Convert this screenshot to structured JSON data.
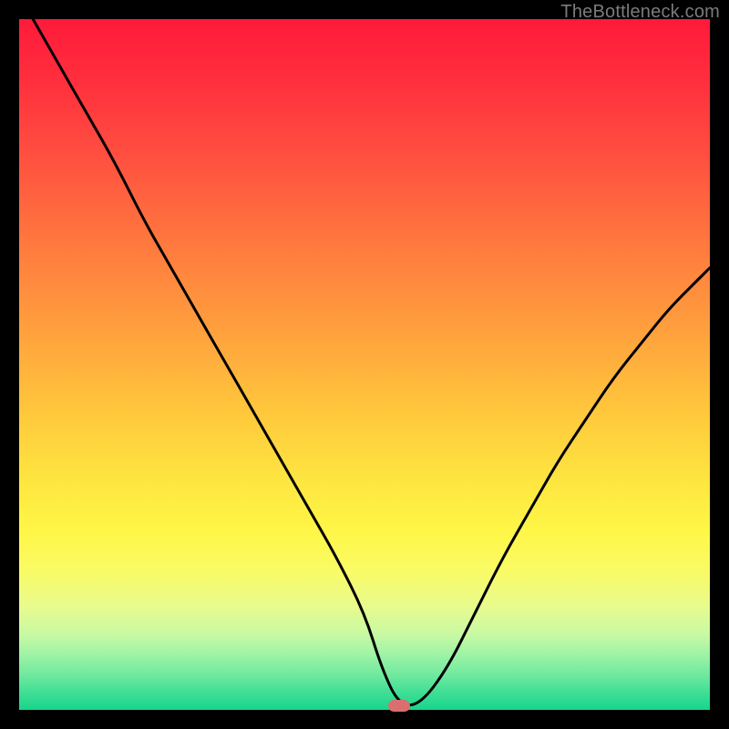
{
  "watermark": "TheBottleneck.com",
  "colors": {
    "frame": "#000000",
    "curve_stroke": "#000000",
    "marker_fill": "#d9706f",
    "watermark_text": "#7b7b7b"
  },
  "chart_data": {
    "type": "line",
    "title": "",
    "xlabel": "",
    "ylabel": "",
    "xlim": [
      0,
      100
    ],
    "ylim": [
      0,
      100
    ],
    "series": [
      {
        "name": "bottleneck-curve",
        "x": [
          2,
          6,
          10,
          14,
          18,
          22,
          26,
          30,
          34,
          38,
          42,
          46,
          50,
          52.5,
          55,
          58,
          62,
          66,
          70,
          74,
          78,
          82,
          86,
          90,
          94,
          98,
          100
        ],
        "y": [
          100,
          93,
          86,
          79,
          71,
          64,
          57,
          50,
          43,
          36,
          29,
          22,
          14,
          6,
          0.7,
          0.7,
          6,
          14,
          22,
          29,
          36,
          42,
          48,
          53,
          58,
          62,
          64
        ]
      }
    ],
    "annotations": [
      {
        "name": "optimal-marker",
        "x": 55,
        "y": 0.7
      }
    ],
    "grid": false,
    "legend": false
  }
}
